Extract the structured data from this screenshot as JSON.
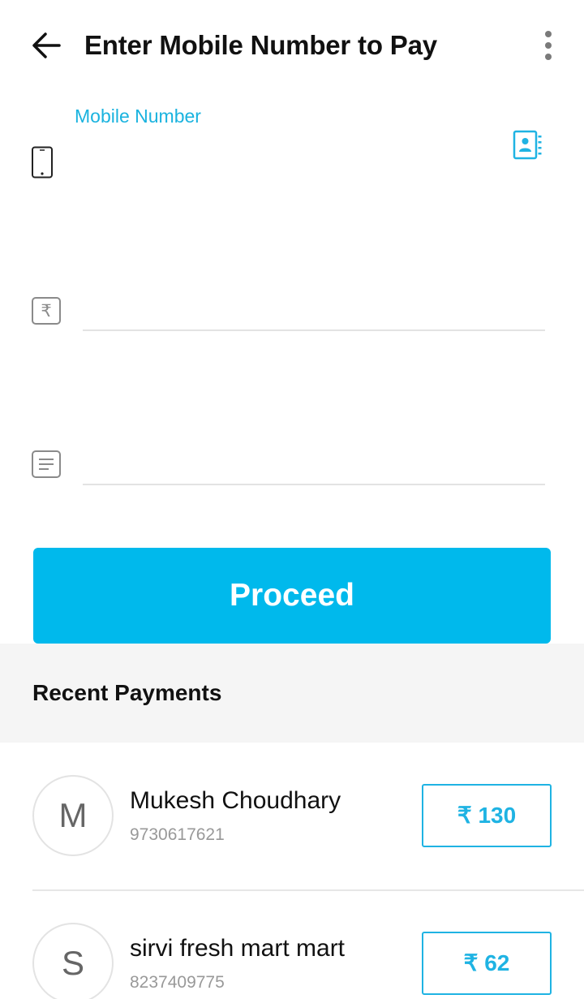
{
  "header": {
    "title": "Enter Mobile Number to Pay"
  },
  "form": {
    "mobile_label": "Mobile Number",
    "mobile_placeholder": "",
    "amount_placeholder": "",
    "note_placeholder": "",
    "proceed_label": "Proceed"
  },
  "recent": {
    "title": "Recent Payments",
    "items": [
      {
        "initial": "M",
        "name": "Mukesh Choudhary",
        "phone": "9730617621",
        "amount": "₹ 130"
      },
      {
        "initial": "S",
        "name": "sirvi fresh mart mart",
        "phone": "8237409775",
        "amount": "₹ 62"
      }
    ]
  },
  "colors": {
    "accent": "#00b9ec",
    "label": "#1ab3df",
    "background": "#ffffff",
    "section_bg": "#f5f5f5"
  },
  "icons": {
    "back": "arrow-left-icon",
    "menu": "more-vertical-icon",
    "phone": "smartphone-icon",
    "contacts": "contact-book-icon",
    "amount": "rupee-icon",
    "note": "note-lines-icon"
  }
}
